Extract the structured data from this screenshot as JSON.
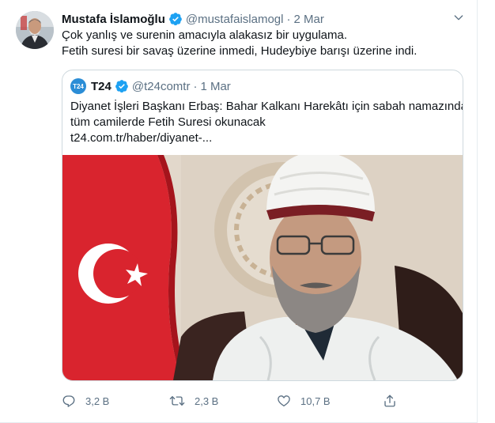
{
  "tweet": {
    "author_name": "Mustafa İslamoğlu",
    "author_handle": "@mustafaislamogl",
    "separator": "·",
    "date": "2 Mar",
    "lines": [
      "Çok yanlış ve surenin amacıyla alakasız bir uygulama.",
      "Fetih suresi bir savaş üzerine inmedi, Hudeybiye barışı üzerine indi."
    ]
  },
  "quoted_tweet": {
    "avatar_text": "T24",
    "author_name": "T24",
    "author_handle": "@t24comtr",
    "separator": "·",
    "date": "1 Mar",
    "lines": [
      "Diyanet İşleri Başkanı Erbaş: Bahar Kalkanı Harekâtı için sabah namazında",
      "tüm camilerde Fetih Suresi okunacak"
    ],
    "link": "t24.com.tr/haber/diyanet-..."
  },
  "actions": {
    "reply_count": "3,2 B",
    "retweet_count": "2,3 B",
    "like_count": "10,7 B"
  },
  "icons": {
    "verified": "verified-badge-icon",
    "caret": "chevron-down-icon",
    "reply": "reply-icon",
    "retweet": "retweet-icon",
    "like": "heart-icon",
    "share": "share-icon"
  },
  "colors": {
    "accent": "#1da1f2",
    "muted": "#5b7083",
    "text": "#0f1419",
    "border": "#cfd9de",
    "flag_red": "#d9242e"
  }
}
